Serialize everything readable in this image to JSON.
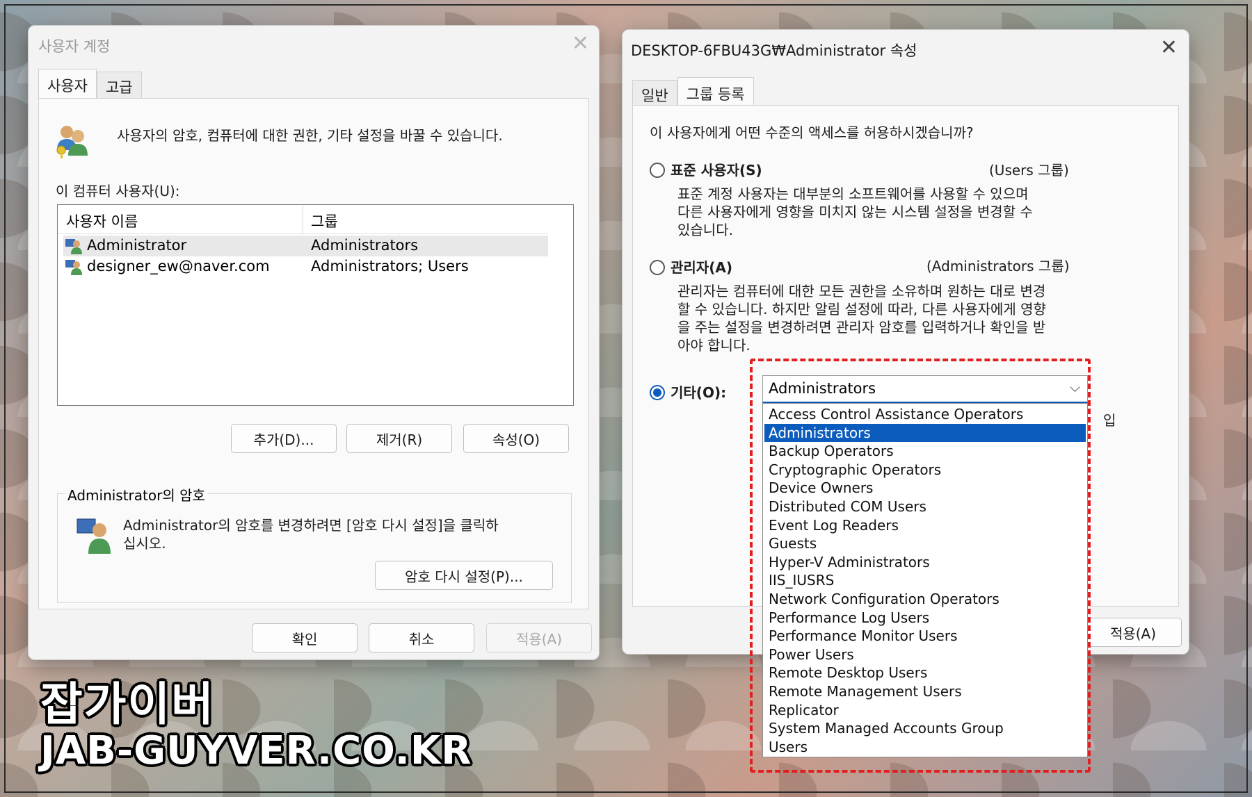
{
  "left_window": {
    "title": "사용자 계정",
    "tabs": [
      "사용자",
      "고급"
    ],
    "description": "사용자의 암호, 컴퓨터에 대한 권한, 기타 설정을 바꿀 수 있습니다.",
    "users_label": "이 컴퓨터 사용자(U):",
    "columns": [
      "사용자 이름",
      "그룹"
    ],
    "rows": [
      {
        "name": "Administrator",
        "group": "Administrators"
      },
      {
        "name": "designer_ew@naver.com",
        "group": "Administrators; Users"
      }
    ],
    "add_label": "추가(D)...",
    "remove_label": "제거(R)",
    "properties_label": "속성(O)",
    "password_group_label": "Administrator의 암호",
    "password_text_1": "Administrator의 암호를 변경하려면 [암호 다시 설정]을 클릭하",
    "password_text_2": "십시오.",
    "reset_password_label": "암호 다시 설정(P)...",
    "ok_label": "확인",
    "cancel_label": "취소",
    "apply_label": "적용(A)"
  },
  "right_window": {
    "title": "DESKTOP-6FBU43G₩Administrator 속성",
    "tabs": [
      "일반",
      "그룹 등록"
    ],
    "question": "이 사용자에게 어떤 수준의 액세스를 허용하시겠습니까?",
    "standard_label": "표준 사용자(S)",
    "standard_group": "(Users 그룹)",
    "standard_desc": [
      "표준 계정 사용자는 대부분의 소프트웨어를 사용할 수 있으며",
      "다른 사용자에게 영향을 미치지 않는 시스템 설정을 변경할 수",
      "있습니다."
    ],
    "admin_label": "관리자(A)",
    "admin_group": "(Administrators 그룹)",
    "admin_desc": [
      "관리자는 컴퓨터에 대한 모든 권한을 소유하며 원하는 대로 변경",
      "할 수 있습니다. 하지만 알림 설정에 따라, 다른 사용자에게 영향",
      "을 주는 설정을 변경하려면 관리자 암호를 입력하거나 확인을 받",
      "아야 합니다."
    ],
    "other_label": "기타(O):",
    "combo_value": "Administrators",
    "partial_text": "입",
    "apply_label": "적용(A)",
    "selected_index": 1,
    "group_options": [
      "Access Control Assistance Operators",
      "Administrators",
      "Backup Operators",
      "Cryptographic Operators",
      "Device Owners",
      "Distributed COM Users",
      "Event Log Readers",
      "Guests",
      "Hyper-V Administrators",
      "IIS_IUSRS",
      "Network Configuration Operators",
      "Performance Log Users",
      "Performance Monitor Users",
      "Power Users",
      "Remote Desktop Users",
      "Remote Management Users",
      "Replicator",
      "System Managed Accounts Group",
      "Users"
    ]
  },
  "watermark": {
    "korean": "잡가이버",
    "english": "JAB-GUYVER.CO.KR"
  },
  "colors": {
    "accent": "#0b5cbd",
    "highlight_border": "#e02020"
  }
}
